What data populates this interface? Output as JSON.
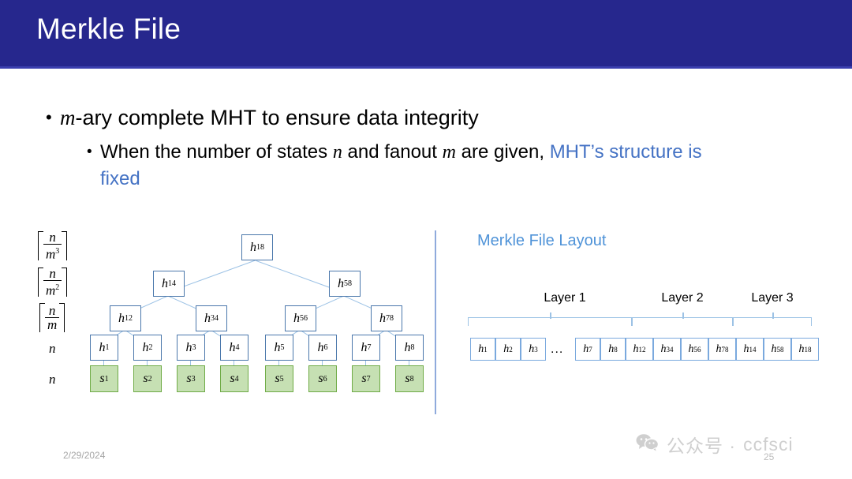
{
  "slide": {
    "title": "Merkle File",
    "header_color": "#26278d",
    "accent_blue": "#4472c4",
    "heading_blue": "#4f93d8",
    "node_border": "#4a77ab",
    "state_fill": "#c6e0b3",
    "state_border": "#6fab46"
  },
  "bullets": {
    "level1": {
      "marker": "•",
      "math_prefix": "m",
      "text": "-ary complete MHT to ensure data integrity"
    },
    "level2": {
      "marker": "•",
      "part1": "When the number of states ",
      "math1": "n",
      "part2": " and fanout ",
      "math2": "m",
      "part3": " are given, ",
      "highlight1": "MHT’s",
      "highlight2": "structure is fixed"
    }
  },
  "tree": {
    "row_labels": [
      {
        "type": "ceil-fraction",
        "num": "n",
        "den": "m",
        "exp": "3",
        "text": "⌈n/m³⌉"
      },
      {
        "type": "ceil-fraction",
        "num": "n",
        "den": "m",
        "exp": "2",
        "text": "⌈n/m²⌉"
      },
      {
        "type": "ceil-fraction",
        "num": "n",
        "den": "m",
        "exp": "",
        "text": "⌈n/m⌉"
      },
      {
        "type": "plain",
        "text": "n"
      },
      {
        "type": "plain",
        "text": "n"
      }
    ],
    "levels": [
      {
        "name": "root",
        "nodes": [
          {
            "label": "h",
            "sub": "18"
          }
        ]
      },
      {
        "name": "level2",
        "nodes": [
          {
            "label": "h",
            "sub": "14"
          },
          {
            "label": "h",
            "sub": "58"
          }
        ]
      },
      {
        "name": "level3",
        "nodes": [
          {
            "label": "h",
            "sub": "12"
          },
          {
            "label": "h",
            "sub": "34"
          },
          {
            "label": "h",
            "sub": "56"
          },
          {
            "label": "h",
            "sub": "78"
          }
        ]
      },
      {
        "name": "hash-leaves",
        "nodes": [
          {
            "label": "h",
            "sub": "1"
          },
          {
            "label": "h",
            "sub": "2"
          },
          {
            "label": "h",
            "sub": "3"
          },
          {
            "label": "h",
            "sub": "4"
          },
          {
            "label": "h",
            "sub": "5"
          },
          {
            "label": "h",
            "sub": "6"
          },
          {
            "label": "h",
            "sub": "7"
          },
          {
            "label": "h",
            "sub": "8"
          }
        ]
      },
      {
        "name": "states",
        "nodes": [
          {
            "label": "s",
            "sub": "1"
          },
          {
            "label": "s",
            "sub": "2"
          },
          {
            "label": "s",
            "sub": "3"
          },
          {
            "label": "s",
            "sub": "4"
          },
          {
            "label": "s",
            "sub": "5"
          },
          {
            "label": "s",
            "sub": "6"
          },
          {
            "label": "s",
            "sub": "7"
          },
          {
            "label": "s",
            "sub": "8"
          }
        ]
      }
    ]
  },
  "layout": {
    "heading": "Merkle File Layout",
    "layers": [
      {
        "label": "Layer 1"
      },
      {
        "label": "Layer 2"
      },
      {
        "label": "Layer 3"
      }
    ],
    "ellipsis": "...",
    "file_boxes": [
      {
        "label": "h",
        "sub": "1"
      },
      {
        "label": "h",
        "sub": "2"
      },
      {
        "label": "h",
        "sub": "3"
      },
      {
        "label": "h",
        "sub": "7"
      },
      {
        "label": "h",
        "sub": "8"
      },
      {
        "label": "h",
        "sub": "12"
      },
      {
        "label": "h",
        "sub": "34"
      },
      {
        "label": "h",
        "sub": "56"
      },
      {
        "label": "h",
        "sub": "78"
      },
      {
        "label": "h",
        "sub": "14"
      },
      {
        "label": "h",
        "sub": "58"
      },
      {
        "label": "h",
        "sub": "18"
      }
    ]
  },
  "footer": {
    "date": "2/29/2024",
    "watermark_text": "公众号 ·",
    "watermark_brand": "ccfsci",
    "page_number": "25"
  }
}
